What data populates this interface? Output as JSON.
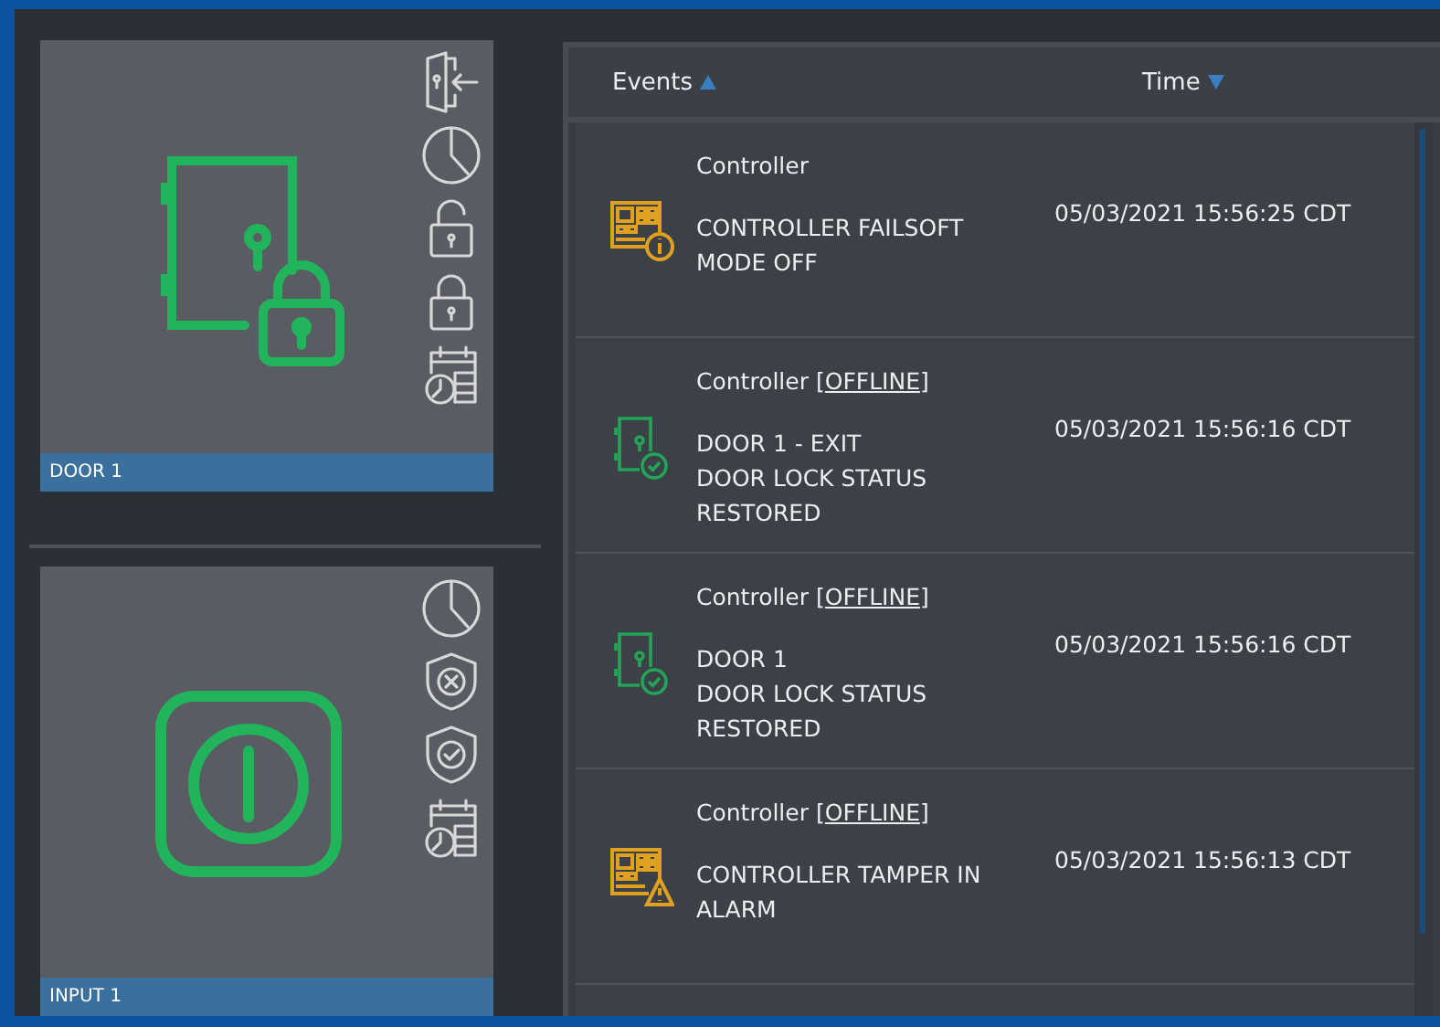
{
  "devices": [
    {
      "kind": "door",
      "label": "DOOR 1"
    },
    {
      "kind": "input",
      "label": "INPUT 1"
    }
  ],
  "events_table": {
    "columns": [
      {
        "label": "Events",
        "sort_ascending": true
      },
      {
        "label": "Time",
        "sort_ascending": false
      }
    ],
    "rows": [
      {
        "kind": "controller-info",
        "source": "Controller",
        "message": [
          "CONTROLLER FAILSOFT MODE OFF"
        ],
        "time": "05/03/2021 15:56:25 CDT"
      },
      {
        "kind": "door-restored",
        "source": "Controller",
        "status": "[OFFLINE]",
        "message": [
          "DOOR 1 - EXIT",
          "DOOR LOCK STATUS RESTORED"
        ],
        "time": "05/03/2021 15:56:16 CDT"
      },
      {
        "kind": "door-restored",
        "source": "Controller",
        "status": "[OFFLINE]",
        "message": [
          "DOOR 1",
          "DOOR LOCK STATUS RESTORED"
        ],
        "time": "05/03/2021 15:56:16 CDT"
      },
      {
        "kind": "controller-warning",
        "source": "Controller",
        "status": "[OFFLINE]",
        "message": [
          "CONTROLLER TAMPER IN ALARM"
        ],
        "time": "05/03/2021 15:56:13 CDT"
      }
    ]
  }
}
